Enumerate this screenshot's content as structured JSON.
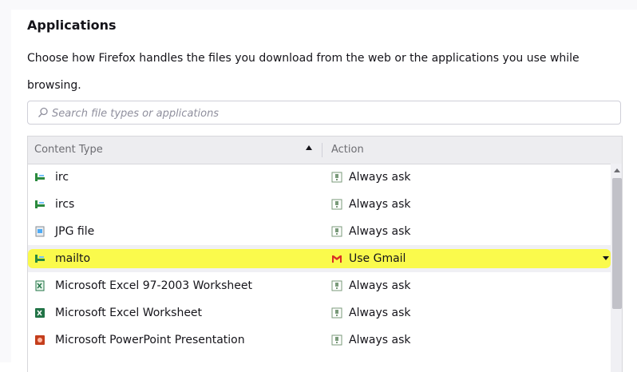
{
  "section": {
    "title": "Applications",
    "description": "Choose how Firefox handles the files you download from the web or the applications you use while browsing."
  },
  "search": {
    "placeholder": "Search file types or applications",
    "value": ""
  },
  "table": {
    "headers": {
      "content_type": "Content Type",
      "action": "Action"
    },
    "rows": [
      {
        "type": "irc",
        "type_icon": "protocol-icon",
        "action": "Always ask",
        "action_icon": "ask-icon"
      },
      {
        "type": "ircs",
        "type_icon": "protocol-icon",
        "action": "Always ask",
        "action_icon": "ask-icon"
      },
      {
        "type": "JPG file",
        "type_icon": "image-file-icon",
        "action": "Always ask",
        "action_icon": "ask-icon"
      },
      {
        "type": "mailto",
        "type_icon": "protocol-icon",
        "action": "Use Gmail",
        "action_icon": "gmail-icon",
        "selected": true
      },
      {
        "type": "Microsoft Excel 97-2003 Worksheet",
        "type_icon": "excel-legacy-icon",
        "action": "Always ask",
        "action_icon": "ask-icon"
      },
      {
        "type": "Microsoft Excel Worksheet",
        "type_icon": "excel-icon",
        "action": "Always ask",
        "action_icon": "ask-icon"
      },
      {
        "type": "Microsoft PowerPoint Presentation",
        "type_icon": "powerpoint-icon",
        "action": "Always ask",
        "action_icon": "ask-icon"
      }
    ]
  },
  "colors": {
    "highlight": "#fbfb3a",
    "gmail_red": "#d93025",
    "protocol_green": "#2b8a3e",
    "excel_green": "#217346",
    "powerpoint_red": "#c43e1c"
  }
}
